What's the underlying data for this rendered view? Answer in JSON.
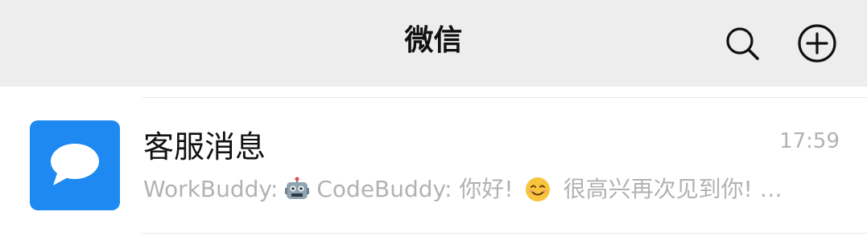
{
  "header": {
    "title": "微信",
    "search_icon": "search-icon",
    "add_icon": "plus-circle-icon"
  },
  "chat": {
    "name": "客服消息",
    "time": "17:59",
    "avatar_icon": "chat-bubble-icon",
    "avatar_color": "#1e89f0",
    "preview_part1": "WorkBuddy:",
    "preview_emoji1": "robot-emoji",
    "preview_part2": "CodeBuddy: 你好!",
    "preview_emoji2": "smiling-face-emoji",
    "preview_part3": "很高兴再次见到你! …"
  }
}
